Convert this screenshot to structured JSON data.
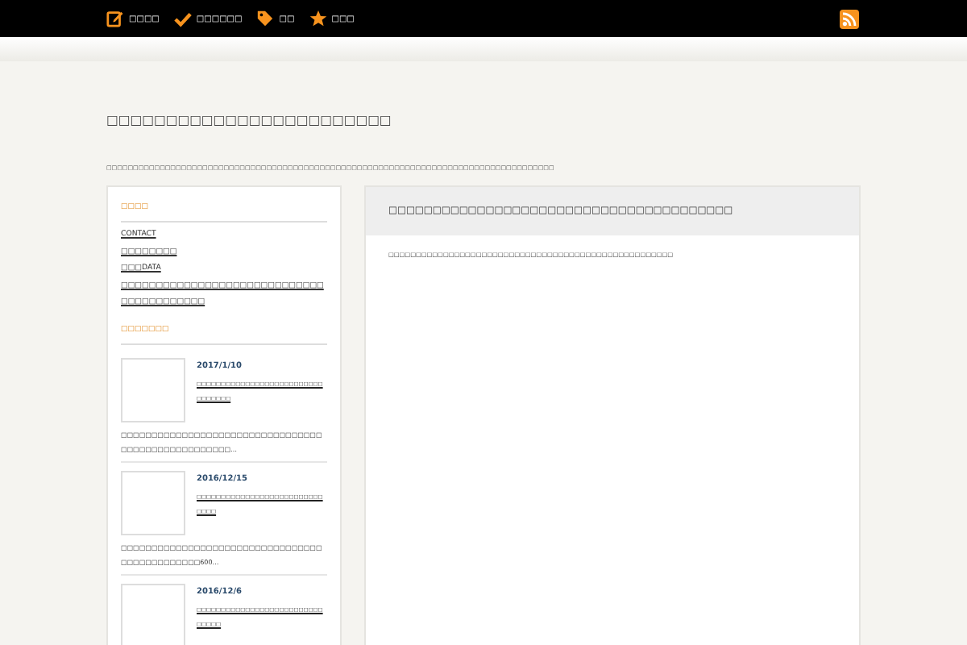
{
  "top_nav": [
    {
      "kind": "edit",
      "label": "□□□□"
    },
    {
      "kind": "check",
      "label": "□□□□□□"
    },
    {
      "kind": "tag",
      "label": "□□"
    },
    {
      "kind": "star",
      "label": "□□□"
    }
  ],
  "site": {
    "title": "□□□□□□□□□□□□□□□□□□□□□□□□",
    "description": "□□□□□□□□□□□□□□□□□□□□□□□□□□□□□□□□□□□□□□□□□□□□□□□□□□□□□□□□□□□□□□□□□□□□□□□□□□□□□□□□□□□□"
  },
  "sidebar": {
    "pages_heading": "□□□□",
    "pages": [
      "CONTACT",
      "□□□□□□□□",
      "□□□DATA",
      "□□□□□□□□□□□□□□□□□□□□□□□□□□□□□□□□□□□□□□□□□"
    ],
    "recent_heading": "□□□□□□□",
    "posts": [
      {
        "date": "2017/1/10",
        "title": "□□□□□□□□□□□□□□□□□□□□□□□□□□□□□□□□□",
        "excerpt": "□□□□□□□□□□□□□□□□□□□□□□□□□□□□□□□□□□□□□□□□□□□□□□□□□□□…"
      },
      {
        "date": "2016/12/15",
        "title": "□□□□□□□□□□□□□□□□□□□□□□□□□□□□□□",
        "excerpt": "□□□□□□□□□□□□□□□□□□□□□□□□□□□□□□□□□□□□□□□□□□□□□□600…"
      },
      {
        "date": "2016/12/6",
        "title": "□□□□□□□□□□□□□□□□□□□□□□□□□□□□□□□"
      }
    ]
  },
  "main": {
    "title": "□□□□□□□□□□□□□□□□□□□□□□□□□□□□□□□□□□□□□□□",
    "body": "□□□□□□□□□□□□□□□□□□□□□□□□□□□□□□□□□□□□□□□□□□□□□□□□□□□□"
  }
}
